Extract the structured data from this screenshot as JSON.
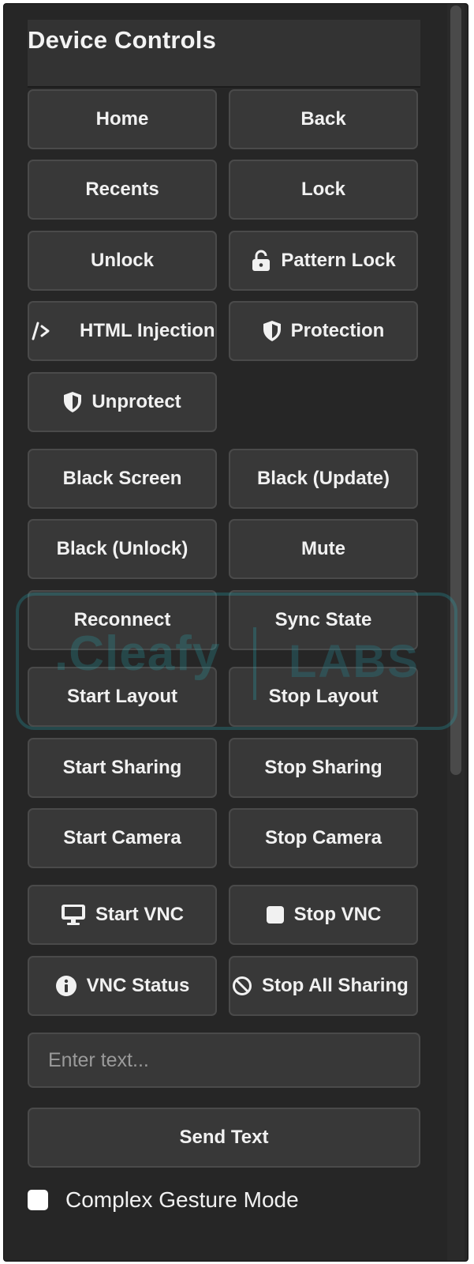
{
  "panel": {
    "title": "Device Controls"
  },
  "buttons": [
    {
      "label": "Home",
      "icon": null
    },
    {
      "label": "Back",
      "icon": null
    },
    {
      "label": "Recents",
      "icon": null
    },
    {
      "label": "Lock",
      "icon": null
    },
    {
      "label": "Unlock",
      "icon": null
    },
    {
      "label": "Pattern Lock",
      "icon": "unlock-icon"
    },
    {
      "label": "HTML Injection",
      "icon": "code-icon"
    },
    {
      "label": "Protection",
      "icon": "shield-icon"
    },
    {
      "label": "Unprotect",
      "icon": "shield-icon"
    },
    {
      "label": "Black Screen",
      "icon": null
    },
    {
      "label": "Black (Update)",
      "icon": null
    },
    {
      "label": "Black (Unlock)",
      "icon": null
    },
    {
      "label": "Mute",
      "icon": null
    },
    {
      "label": "Reconnect",
      "icon": null
    },
    {
      "label": "Sync State",
      "icon": null
    },
    {
      "label": "Start Layout",
      "icon": null
    },
    {
      "label": "Stop Layout",
      "icon": null
    },
    {
      "label": "Start Sharing",
      "icon": null
    },
    {
      "label": "Stop Sharing",
      "icon": null
    },
    {
      "label": "Start Camera",
      "icon": null
    },
    {
      "label": "Stop Camera",
      "icon": null
    },
    {
      "label": "Start VNC",
      "icon": "desktop-icon"
    },
    {
      "label": "Stop VNC",
      "icon": "stop-square-icon"
    },
    {
      "label": "VNC Status",
      "icon": "info-circle-icon"
    },
    {
      "label": "Stop All Sharing",
      "icon": "ban-icon"
    }
  ],
  "text_input": {
    "placeholder": "Enter text...",
    "value": ""
  },
  "send_button": {
    "label": "Send Text"
  },
  "gesture_mode": {
    "label": "Complex Gesture Mode",
    "checked": false
  },
  "watermark": {
    "brand": ".Cleafy",
    "sub": "LABS"
  },
  "colors": {
    "panel_bg": "#262626",
    "button_bg": "#383838",
    "button_border": "#4a4a4a",
    "text": "#f1f1f1",
    "watermark": "#25a5af"
  }
}
